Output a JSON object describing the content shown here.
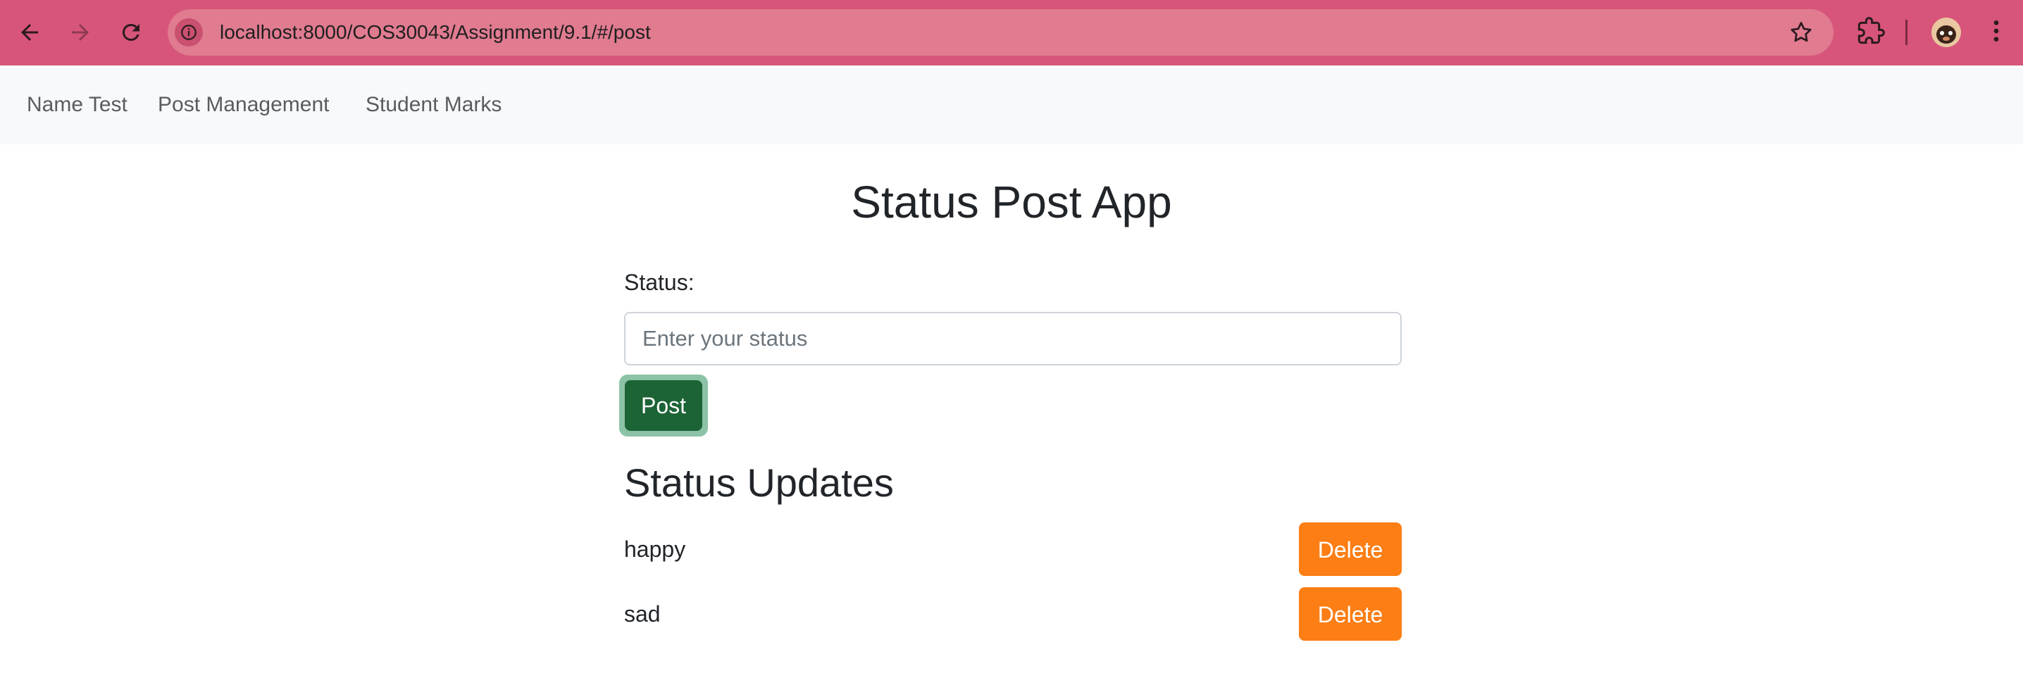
{
  "browser": {
    "url": "localhost:8000/COS30043/Assignment/9.1/#/post",
    "chrome_color": "#d7557a"
  },
  "navbar": {
    "items": [
      {
        "label": "Name Test"
      },
      {
        "label": "Post Management"
      },
      {
        "label": "Student Marks"
      }
    ]
  },
  "main": {
    "title": "Status Post App",
    "status_label": "Status:",
    "status_input": {
      "value": "",
      "placeholder": "Enter your status"
    },
    "post_button": "Post",
    "updates_title": "Status Updates",
    "updates": [
      {
        "text": "happy",
        "action": "Delete"
      },
      {
        "text": "sad",
        "action": "Delete"
      }
    ],
    "colors": {
      "post_button": "#1c6336",
      "delete_button": "#fd7e14"
    }
  }
}
